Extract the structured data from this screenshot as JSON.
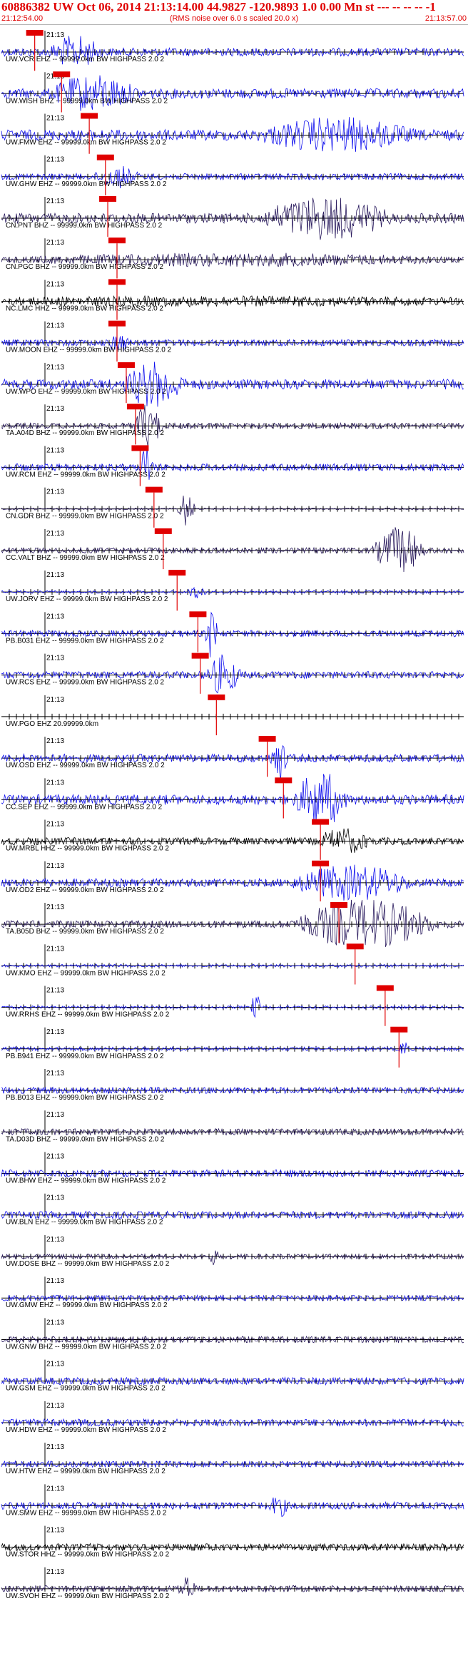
{
  "header": {
    "title": "60886382 UW Oct 06, 2014 21:13:14.00   44.9827 -120.9893  1.0 0.00 Mn st --- -- -- --  -1",
    "time_start": "21:12:54.00",
    "time_end": "21:13:57.00",
    "subtitle": "(RMS noise over 6.0 s scaled 20.0 x)"
  },
  "minute_label": "21:13",
  "colors": {
    "accent": "#e00000",
    "blue": "#1010ee",
    "navy": "#2a1b5e",
    "black": "#000000",
    "grid": "#000000"
  },
  "chart_data": {
    "type": "line",
    "title": "60886382 UW Oct 06, 2014 21:13:14.00   44.9827 -120.9893  1.0 0.00 Mn st --- -- -- --  -1",
    "x_range": [
      "21:12:54.00",
      "21:13:57.00"
    ],
    "tick_interval_s": 1,
    "minute_marker": "21:13",
    "traces": [
      {
        "label": "UW.VCR EHZ -- 99999.0km BW  HIGHPASS  2.0  2",
        "color": "blue",
        "amp": 0.45,
        "pick": 0.072,
        "burst": [
          0.1,
          0.22,
          0.9
        ]
      },
      {
        "label": "UW.WISH BHZ -- 99999.0km BW  HIGHPASS  2.0  2",
        "color": "blue",
        "amp": 0.55,
        "pick": 0.13,
        "burst": [
          0.1,
          0.3,
          1.0
        ]
      },
      {
        "label": "UW.FMW EHZ -- 99999.0km BW  HIGHPASS  2.0  2",
        "color": "blue",
        "amp": 0.6,
        "pick": 0.19,
        "burst": [
          0.55,
          0.9,
          0.9
        ]
      },
      {
        "label": "UW.GHW EHZ -- 99999.0km BW  HIGHPASS  2.0  2",
        "color": "blue",
        "amp": 0.35,
        "pick": 0.225,
        "burst": [
          0.2,
          0.3,
          0.6
        ]
      },
      {
        "label": "CN.PNT BHZ -- 99999.0km BW  HIGHPASS  2.0  2",
        "color": "navy",
        "amp": 0.55,
        "pick": 0.23,
        "burst": [
          0.55,
          0.85,
          1.2
        ]
      },
      {
        "label": "CN.PGC BHZ -- 99999.0km BW  HIGHPASS  2.0  2",
        "color": "navy",
        "amp": 0.3,
        "pick": 0.25,
        "burst": [
          0.0,
          1.0,
          0.3
        ]
      },
      {
        "label": "NC.LMC HHZ -- 99999.0km BW  HIGHPASS  2.0  2",
        "color": "black",
        "amp": 0.45,
        "pick": 0.25,
        "burst": [
          0.0,
          1.0,
          0.1
        ]
      },
      {
        "label": "UW.MOON EHZ -- 99999.0km BW  HIGHPASS  2.0  2",
        "color": "blue",
        "amp": 0.35,
        "pick": 0.25,
        "burst": [
          0.23,
          0.28,
          0.5
        ]
      },
      {
        "label": "UW.WPO EHZ -- 99999.0km BW  HIGHPASS  2.0  2",
        "color": "blue",
        "amp": 0.55,
        "pick": 0.27,
        "burst": [
          0.26,
          0.4,
          1.3
        ]
      },
      {
        "label": "TA.A04D BHZ -- 99999.0km BW  HIGHPASS  2.0  2",
        "color": "navy",
        "amp": 0.3,
        "pick": 0.29,
        "burst": [
          0.28,
          0.35,
          1.4
        ]
      },
      {
        "label": "UW.RCM EHZ -- 99999.0km BW  HIGHPASS  2.0  2",
        "color": "blue",
        "amp": 0.4,
        "pick": 0.3,
        "burst": [
          0.3,
          0.33,
          1.5
        ]
      },
      {
        "label": "CN.GDR BHZ -- 99999.0km BW  HIGHPASS  2.0  2",
        "color": "navy",
        "amp": 0.1,
        "pick": 0.33,
        "burst": [
          0.38,
          0.42,
          1.2
        ]
      },
      {
        "label": "CC.VALT BHZ -- 99999.0km BW  HIGHPASS  2.0  2",
        "color": "navy",
        "amp": 0.3,
        "pick": 0.35,
        "burst": [
          0.8,
          0.92,
          1.5
        ]
      },
      {
        "label": "UW.JORV EHZ -- 99999.0km BW  HIGHPASS  2.0  2",
        "color": "blue",
        "amp": 0.15,
        "pick": 0.38,
        "burst": [
          0.4,
          0.45,
          0.4
        ]
      },
      {
        "label": "PB.B031 EHZ -- 99999.0km BW  HIGHPASS  2.0  2",
        "color": "blue",
        "amp": 0.35,
        "pick": 0.425,
        "burst": [
          0.44,
          0.47,
          1.6
        ]
      },
      {
        "label": "UW.RCS EHZ -- 99999.0km BW  HIGHPASS  2.0  2",
        "color": "blue",
        "amp": 0.4,
        "pick": 0.43,
        "burst": [
          0.44,
          0.52,
          1.2
        ]
      },
      {
        "label": "UW.PGO EHZ 20.99999.0km",
        "color": "blue",
        "amp": 0.0,
        "pick": 0.465,
        "burst": [
          0.0,
          0.0,
          0.0
        ]
      },
      {
        "label": "UW.OSD EHZ -- 99999.0km BW  HIGHPASS  2.0  2",
        "color": "blue",
        "amp": 0.45,
        "pick": 0.575,
        "burst": [
          0.58,
          0.62,
          1.3
        ]
      },
      {
        "label": "CC.SEP EHZ -- 99999.0km BW  HIGHPASS  2.0  2",
        "color": "blue",
        "amp": 0.55,
        "pick": 0.61,
        "burst": [
          0.63,
          0.75,
          1.7
        ]
      },
      {
        "label": "UW.MRBL HHZ -- 99999.0km BW  HIGHPASS  2.0  2",
        "color": "black",
        "amp": 0.4,
        "pick": 0.69,
        "burst": [
          0.68,
          0.8,
          0.7
        ]
      },
      {
        "label": "UW.OD2 EHZ -- 99999.0km BW  HIGHPASS  2.0  2",
        "color": "blue",
        "amp": 0.45,
        "pick": 0.69,
        "burst": [
          0.62,
          0.9,
          1.0
        ]
      },
      {
        "label": "TA.B05D BHZ -- 99999.0km BW  HIGHPASS  2.0  2",
        "color": "navy",
        "amp": 0.4,
        "pick": 0.73,
        "burst": [
          0.62,
          0.95,
          1.5
        ]
      },
      {
        "label": "UW.KMO EHZ -- 99999.0km BW  HIGHPASS  2.0  2",
        "color": "blue",
        "amp": 0.15,
        "pick": 0.765,
        "burst": [
          0.0,
          0.0,
          0.0
        ]
      },
      {
        "label": "UW.RRHS EHZ -- 99999.0km BW  HIGHPASS  2.0  2",
        "color": "blue",
        "amp": 0.15,
        "pick": 0.83,
        "burst": [
          0.54,
          0.56,
          1.0
        ]
      },
      {
        "label": "PB.B941 EHZ -- 99999.0km BW  HIGHPASS  2.0  2",
        "color": "blue",
        "amp": 0.2,
        "pick": 0.86,
        "burst": [
          0.86,
          0.88,
          0.6
        ]
      },
      {
        "label": "PB.B013 EHZ -- 99999.0km BW  HIGHPASS  2.0  2",
        "color": "blue",
        "amp": 0.35,
        "pick": null,
        "burst": [
          0.0,
          0.0,
          0.0
        ]
      },
      {
        "label": "TA.D03D BHZ -- 99999.0km BW  HIGHPASS  2.0  2",
        "color": "navy",
        "amp": 0.35,
        "pick": null,
        "burst": [
          0.0,
          0.0,
          0.0
        ]
      },
      {
        "label": "UW.BHW EHZ -- 99999.0km BW  HIGHPASS  2.0  2",
        "color": "blue",
        "amp": 0.4,
        "pick": null,
        "burst": [
          0.0,
          0.0,
          0.0
        ]
      },
      {
        "label": "UW.BLN EHZ -- 99999.0km BW  HIGHPASS  2.0  2",
        "color": "blue",
        "amp": 0.4,
        "pick": null,
        "burst": [
          0.0,
          0.0,
          0.0
        ]
      },
      {
        "label": "UW.DOSE BHZ -- 99999.0km BW  HIGHPASS  2.0  2",
        "color": "navy",
        "amp": 0.25,
        "pick": null,
        "burst": [
          0.45,
          0.47,
          0.5
        ]
      },
      {
        "label": "UW.GMW EHZ -- 99999.0km BW  HIGHPASS  2.0  2",
        "color": "blue",
        "amp": 0.3,
        "pick": null,
        "burst": [
          0.0,
          0.0,
          0.0
        ]
      },
      {
        "label": "UW.GNW BHZ -- 99999.0km BW  HIGHPASS  2.0  2",
        "color": "navy",
        "amp": 0.35,
        "pick": null,
        "burst": [
          0.0,
          0.0,
          0.0
        ]
      },
      {
        "label": "UW.GSM EHZ -- 99999.0km BW  HIGHPASS  2.0  2",
        "color": "blue",
        "amp": 0.4,
        "pick": null,
        "burst": [
          0.0,
          0.0,
          0.0
        ]
      },
      {
        "label": "UW.HDW EHZ -- 99999.0km BW  HIGHPASS  2.0  2",
        "color": "blue",
        "amp": 0.4,
        "pick": null,
        "burst": [
          0.0,
          0.0,
          0.0
        ]
      },
      {
        "label": "UW.HTW EHZ -- 99999.0km BW  HIGHPASS  2.0  2",
        "color": "blue",
        "amp": 0.35,
        "pick": null,
        "burst": [
          0.0,
          0.0,
          0.0
        ]
      },
      {
        "label": "UW.SMW EHZ -- 99999.0km BW  HIGHPASS  2.0  2",
        "color": "blue",
        "amp": 0.4,
        "pick": null,
        "burst": [
          0.58,
          0.62,
          0.6
        ]
      },
      {
        "label": "UW.STOR HHZ -- 99999.0km BW  HIGHPASS  2.0  2",
        "color": "black",
        "amp": 0.4,
        "pick": null,
        "burst": [
          0.0,
          0.0,
          0.0
        ]
      },
      {
        "label": "UW.SVOH EHZ -- 99999.0km BW  HIGHPASS  2.0  2",
        "color": "navy",
        "amp": 0.35,
        "pick": null,
        "burst": [
          0.38,
          0.42,
          0.8
        ]
      }
    ]
  }
}
